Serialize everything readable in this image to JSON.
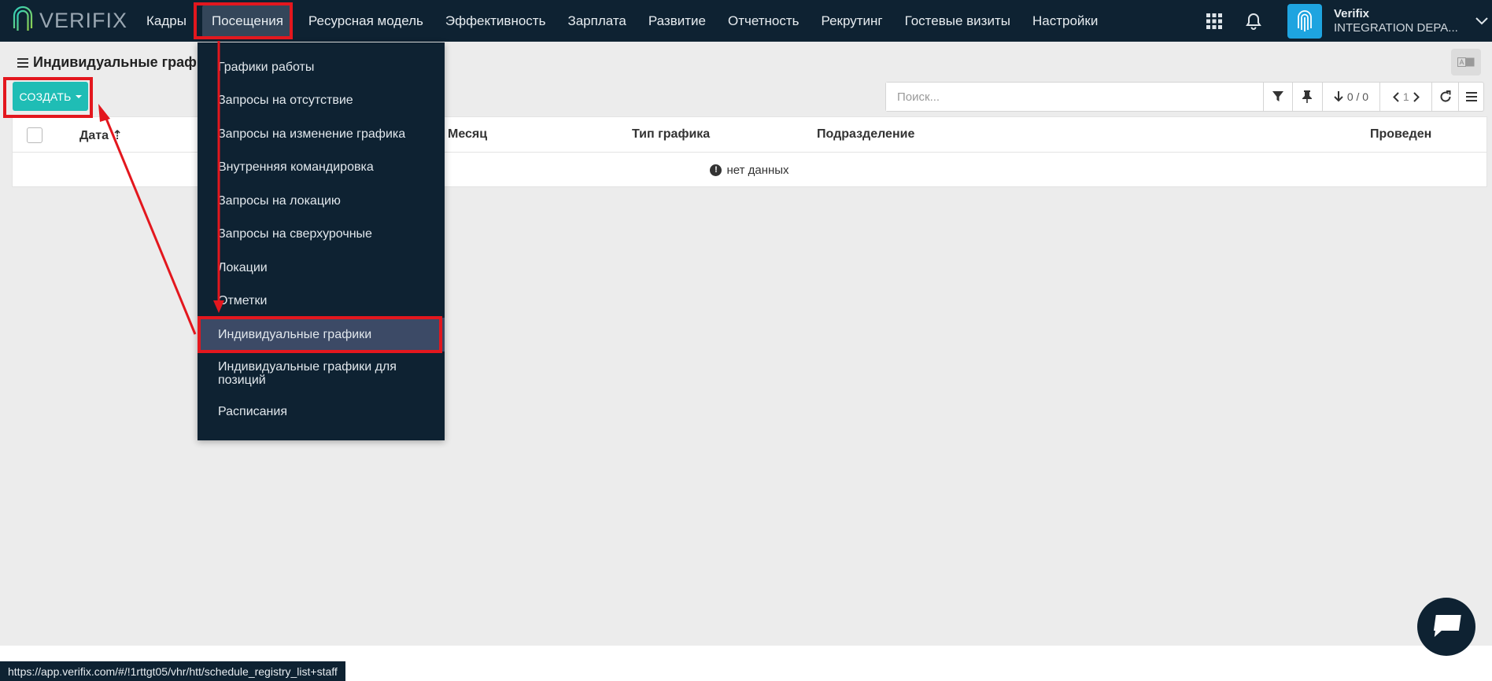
{
  "app": {
    "logo_text": "VERIFIX"
  },
  "nav": {
    "items": [
      "Кадры",
      "Посещения",
      "Ресурсная модель",
      "Эффективность",
      "Зарплата",
      "Развитие",
      "Отчетность",
      "Рекрутинг",
      "Гостевые визиты",
      "Настройки"
    ],
    "active": "Посещения"
  },
  "user": {
    "name": "Verifix",
    "org": "INTEGRATION DEPA..."
  },
  "page": {
    "title": "Индивидуальные графи"
  },
  "toolbar": {
    "create_label": "СОЗДАТЬ",
    "search_placeholder": "Поиск...",
    "pager_count": "0 / 0",
    "page_number": "1"
  },
  "table": {
    "columns": [
      "Дата",
      "Месяц",
      "Тип графика",
      "Подразделение",
      "Проведен"
    ],
    "empty_text": "нет данных"
  },
  "dropdown": {
    "items": [
      "Графики работы",
      "Запросы на отсутствие",
      "Запросы на изменение графика",
      "Внутренняя командировка",
      "Запросы на локацию",
      "Запросы на сверхурочные",
      "Локации",
      "Отметки",
      "Индивидуальные графики",
      "Индивидуальные графики для позиций",
      "Расписания"
    ],
    "active": "Индивидуальные графики"
  },
  "status_bar": {
    "url": "https://app.verifix.com/#/!1rttgt05/vhr/htt/schedule_registry_list+staff"
  },
  "colors": {
    "navbar": "#0e2232",
    "accent": "#1fbdb5",
    "annotation": "#e3171e",
    "avatar": "#1ea4e0"
  },
  "icons": [
    "fingerprint-logo-icon",
    "apps-grid-icon",
    "bell-icon",
    "fingerprint-avatar-icon",
    "chevron-down-icon",
    "hamburger-icon",
    "translate-icon",
    "filter-icon",
    "pin-icon",
    "sort-down-icon",
    "chevron-left-icon",
    "chevron-right-icon",
    "refresh-icon",
    "list-menu-icon",
    "info-icon",
    "chat-icon"
  ]
}
